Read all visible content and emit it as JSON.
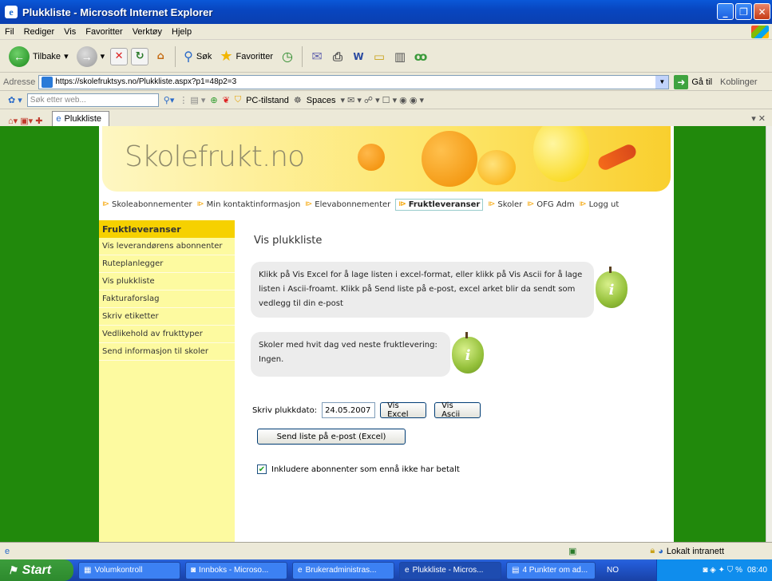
{
  "window": {
    "title": "Plukkliste - Microsoft Internet Explorer"
  },
  "menu": [
    "Fil",
    "Rediger",
    "Vis",
    "Favoritter",
    "Verktøy",
    "Hjelp"
  ],
  "toolbar": {
    "back": "Tilbake",
    "search": "Søk",
    "favorites": "Favoritter"
  },
  "address": {
    "label": "Adresse",
    "url": "https://skolefruktsys.no/Plukkliste.aspx?p1=48p2=3",
    "go": "Gå til",
    "links": "Koblinger"
  },
  "searchbar": {
    "placeholder": "Søk etter web...",
    "pc_status": "PC-tilstand",
    "spaces": "Spaces"
  },
  "tab": {
    "label": "Plukkliste"
  },
  "site": {
    "logo": "Skolefrukt.no"
  },
  "nav": [
    "Skoleabonnementer",
    "Min kontaktinformasjon",
    "Elevabonnementer",
    "Fruktleveranser",
    "Skoler",
    "OFG Adm",
    "Logg ut"
  ],
  "sidebar": {
    "header": "Fruktleveranser",
    "items": [
      "Vis leverandørens abonnenter",
      "Ruteplanlegger",
      "Vis plukkliste",
      "Fakturaforslag",
      "Skriv etiketter",
      "Vedlikehold av frukttyper",
      "Send informasjon til skoler"
    ]
  },
  "main": {
    "title": "Vis plukkliste",
    "info": "Klikk på Vis Excel for å lage listen i excel-format, eller klikk på Vis Ascii for å lage listen i Ascii-froamt. Klikk på Send liste på e-post, excel arket blir da sendt som vedlegg til din e-post",
    "schools_label": "Skoler med hvit dag ved neste fruktlevering:",
    "schools_value": "Ingen.",
    "date_label": "Skriv plukkdato:",
    "date_value": "24.05.2007",
    "btn_excel": "Vis Excel",
    "btn_ascii": "Vis Ascii",
    "btn_send": "Send liste på e-post (Excel)",
    "checkbox_label": "Inkludere abonnenter som ennå ikke har betalt"
  },
  "status": {
    "zone": "Lokalt intranett"
  },
  "taskbar": {
    "start": "Start",
    "tasks": [
      "Volumkontroll",
      "Innboks - Microso...",
      "Brukeradministras...",
      "Plukkliste - Micros...",
      "4 Punkter om ad..."
    ],
    "lang": "NO",
    "time": "08:40"
  }
}
